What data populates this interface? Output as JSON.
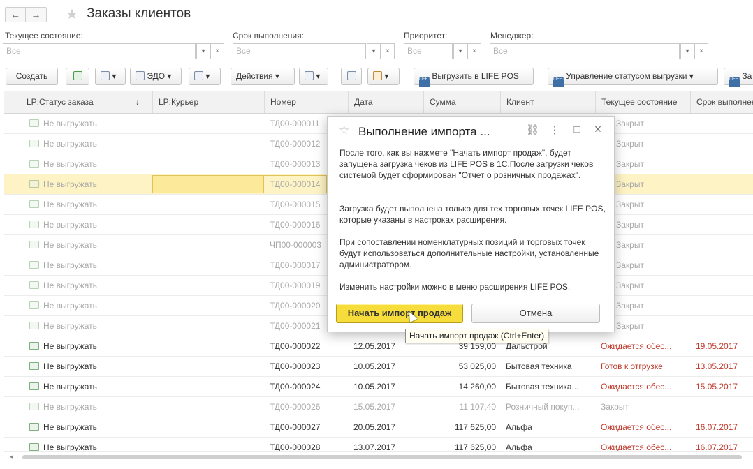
{
  "header": {
    "back": "←",
    "forward": "→",
    "title": "Заказы клиентов"
  },
  "filters": {
    "state": {
      "label": "Текущее состояние:",
      "value": "Все"
    },
    "deadline": {
      "label": "Срок выполнения:",
      "value": "Все"
    },
    "priority": {
      "label": "Приоритет:",
      "value": "Все"
    },
    "manager": {
      "label": "Менеджер:",
      "value": "Все"
    },
    "dropdown": "▾",
    "clear": "×"
  },
  "toolbar": {
    "create": "Создать",
    "edo": "ЭДО",
    "actions": "Действия",
    "upload": "Выгрузить в LIFE POS",
    "status": "Управление статусом выгрузки",
    "more": "За",
    "lp_icon": "LIFE POS",
    "caret": "▾"
  },
  "table": {
    "columns": [
      "LP:Статус заказа",
      "↓",
      "LP:Курьер",
      "Номер",
      "Дата",
      "Сумма",
      "Клиент",
      "Текущее состояние",
      "Срок выполнения"
    ],
    "rows": [
      {
        "status": "Не выгружать",
        "number": "ТД00-000011",
        "date": "",
        "sum": "",
        "client": "",
        "state": "Закрыт",
        "deadline": ""
      },
      {
        "status": "Не выгружать",
        "number": "ТД00-000012",
        "date": "",
        "sum": "",
        "client": "",
        "state": "Закрыт",
        "deadline": ""
      },
      {
        "status": "Не выгружать",
        "number": "ТД00-000013",
        "date": "",
        "sum": "",
        "client": "",
        "state": "Закрыт",
        "deadline": ""
      },
      {
        "status": "Не выгружать",
        "number": "ТД00-000014",
        "date": "",
        "sum": "",
        "client": "",
        "state": "Закрыт",
        "deadline": ""
      },
      {
        "status": "Не выгружать",
        "number": "ТД00-000015",
        "date": "",
        "sum": "",
        "client": "",
        "state": "Закрыт",
        "deadline": ""
      },
      {
        "status": "Не выгружать",
        "number": "ТД00-000016",
        "date": "",
        "sum": "",
        "client": "",
        "state": "Закрыт",
        "deadline": ""
      },
      {
        "status": "Не выгружать",
        "number": "ЧП00-000003",
        "date": "",
        "sum": "",
        "client": "",
        "state": "Закрыт",
        "deadline": ""
      },
      {
        "status": "Не выгружать",
        "number": "ТД00-000017",
        "date": "",
        "sum": "",
        "client": "",
        "state": "Закрыт",
        "deadline": ""
      },
      {
        "status": "Не выгружать",
        "number": "ТД00-000019",
        "date": "",
        "sum": "",
        "client": "",
        "state": "Закрыт",
        "deadline": ""
      },
      {
        "status": "Не выгружать",
        "number": "ТД00-000020",
        "date": "",
        "sum": "",
        "client": "",
        "state": "Закрыт",
        "deadline": ""
      },
      {
        "status": "Не выгружать",
        "number": "ТД00-000021",
        "date": "",
        "sum": "",
        "client": "",
        "state": "Закрыт",
        "deadline": ""
      },
      {
        "status": "Не выгружать",
        "number": "ТД00-000022",
        "date": "12.05.2017",
        "sum": "39 159,00",
        "client": "Дальстрой",
        "state": "Ожидается обес...",
        "deadline": "19.05.2017"
      },
      {
        "status": "Не выгружать",
        "number": "ТД00-000023",
        "date": "10.05.2017",
        "sum": "53 025,00",
        "client": "Бытовая техника",
        "state": "Готов к отгрузке",
        "deadline": "13.05.2017"
      },
      {
        "status": "Не выгружать",
        "number": "ТД00-000024",
        "date": "10.05.2017",
        "sum": "14 260,00",
        "client": "Бытовая техника...",
        "state": "Ожидается обес...",
        "deadline": "15.05.2017"
      },
      {
        "status": "Не выгружать",
        "number": "ТД00-000026",
        "date": "15.05.2017",
        "sum": "11 107,40",
        "client": "Розничный покуп...",
        "state": "Закрыт",
        "deadline": ""
      },
      {
        "status": "Не выгружать",
        "number": "ТД00-000027",
        "date": "20.05.2017",
        "sum": "117 625,00",
        "client": "Альфа",
        "state": "Ожидается обес...",
        "deadline": "16.07.2017"
      },
      {
        "status": "Не выгружать",
        "number": "ТД00-000028",
        "date": "13.07.2017",
        "sum": "117 625,00",
        "client": "Альфа",
        "state": "Ожидается обес...",
        "deadline": "16.07.2017"
      }
    ]
  },
  "dialog": {
    "title": "Выполнение импорта ...",
    "p1": "После того, как вы нажмете \"Начать импорт продаж\", будет запущена загрузка чеков из LIFE POS в 1С.После загрузки чеков системой будет сформирован \"Отчет о розничных продажах\".",
    "p2": "Загрузка будет выполнена только для тех торговых точек LIFE POS, которые указаны в настроках расширения.",
    "p3": "При сопоставлении номенклатурных позиций и торговых точек будут использоваться дополнительные настройки, установленные администратором.",
    "p4": "Изменить настройки можно в меню расширения LIFE POS.",
    "primary": "Начать импорт продаж",
    "secondary": "Отмена",
    "tooltip": "Начать импорт продаж (Ctrl+Enter)"
  },
  "icons": {
    "star": "☆",
    "link": "⛓",
    "more": "⋮",
    "maximize": "□",
    "close": "×"
  }
}
